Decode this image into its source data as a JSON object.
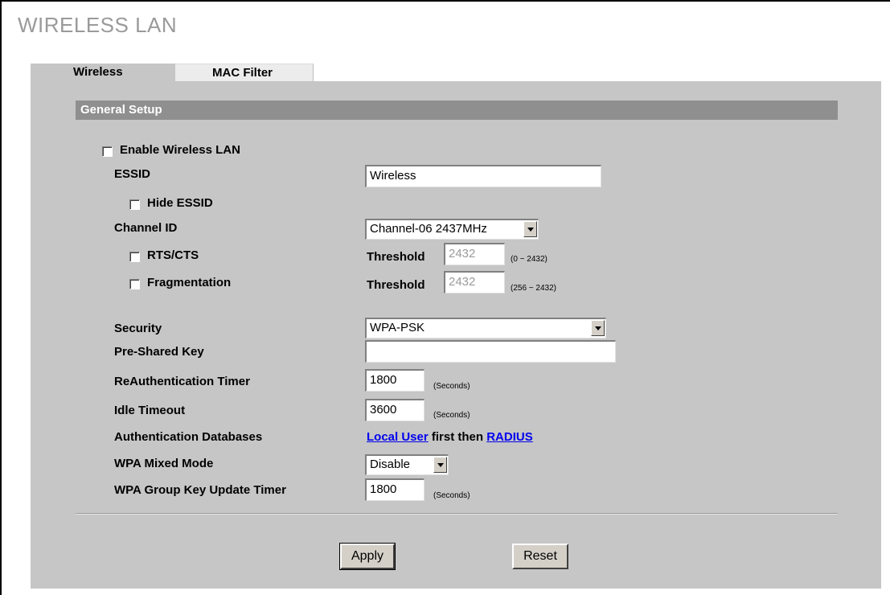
{
  "page": {
    "title": "WIRELESS LAN"
  },
  "tabs": [
    {
      "label": "Wireless",
      "active": true
    },
    {
      "label": "MAC Filter",
      "active": false
    }
  ],
  "general_setup": {
    "heading": "General Setup",
    "enable_wireless_label": "Enable Wireless LAN",
    "enable_wireless_checked": false,
    "essid_label": "ESSID",
    "essid_value": "Wireless",
    "hide_essid_label": "Hide ESSID",
    "hide_essid_checked": false,
    "channel_label": "Channel ID",
    "channel_value": "Channel-06 2437MHz",
    "rts_label": "RTS/CTS",
    "rts_checked": false,
    "rts_threshold_label": "Threshold",
    "rts_threshold_value": "2432",
    "rts_range": "(0 ~ 2432)",
    "frag_label": "Fragmentation",
    "frag_checked": false,
    "frag_threshold_label": "Threshold",
    "frag_threshold_value": "2432",
    "frag_range": "(256 ~ 2432)",
    "security_label": "Security",
    "security_value": "WPA-PSK",
    "psk_label": "Pre-Shared Key",
    "psk_value": "",
    "reauth_label": "ReAuthentication Timer",
    "reauth_value": "1800",
    "reauth_unit": "(Seconds)",
    "idle_label": "Idle Timeout",
    "idle_value": "3600",
    "idle_unit": "(Seconds)",
    "authdb_label": "Authentication Databases",
    "authdb_first_link": "Local User",
    "authdb_middle": " first then ",
    "authdb_second_link": "RADIUS",
    "wpa_mixed_label": "WPA Mixed Mode",
    "wpa_mixed_value": "Disable",
    "group_key_label": "WPA Group Key Update Timer",
    "group_key_value": "1800",
    "group_key_unit": "(Seconds)"
  },
  "buttons": {
    "apply": "Apply",
    "reset": "Reset"
  },
  "colors": {
    "panel": "#c6c6c6",
    "section_bar": "#8f8f8f",
    "title": "#9a9a9a",
    "link": "#0000ee"
  }
}
